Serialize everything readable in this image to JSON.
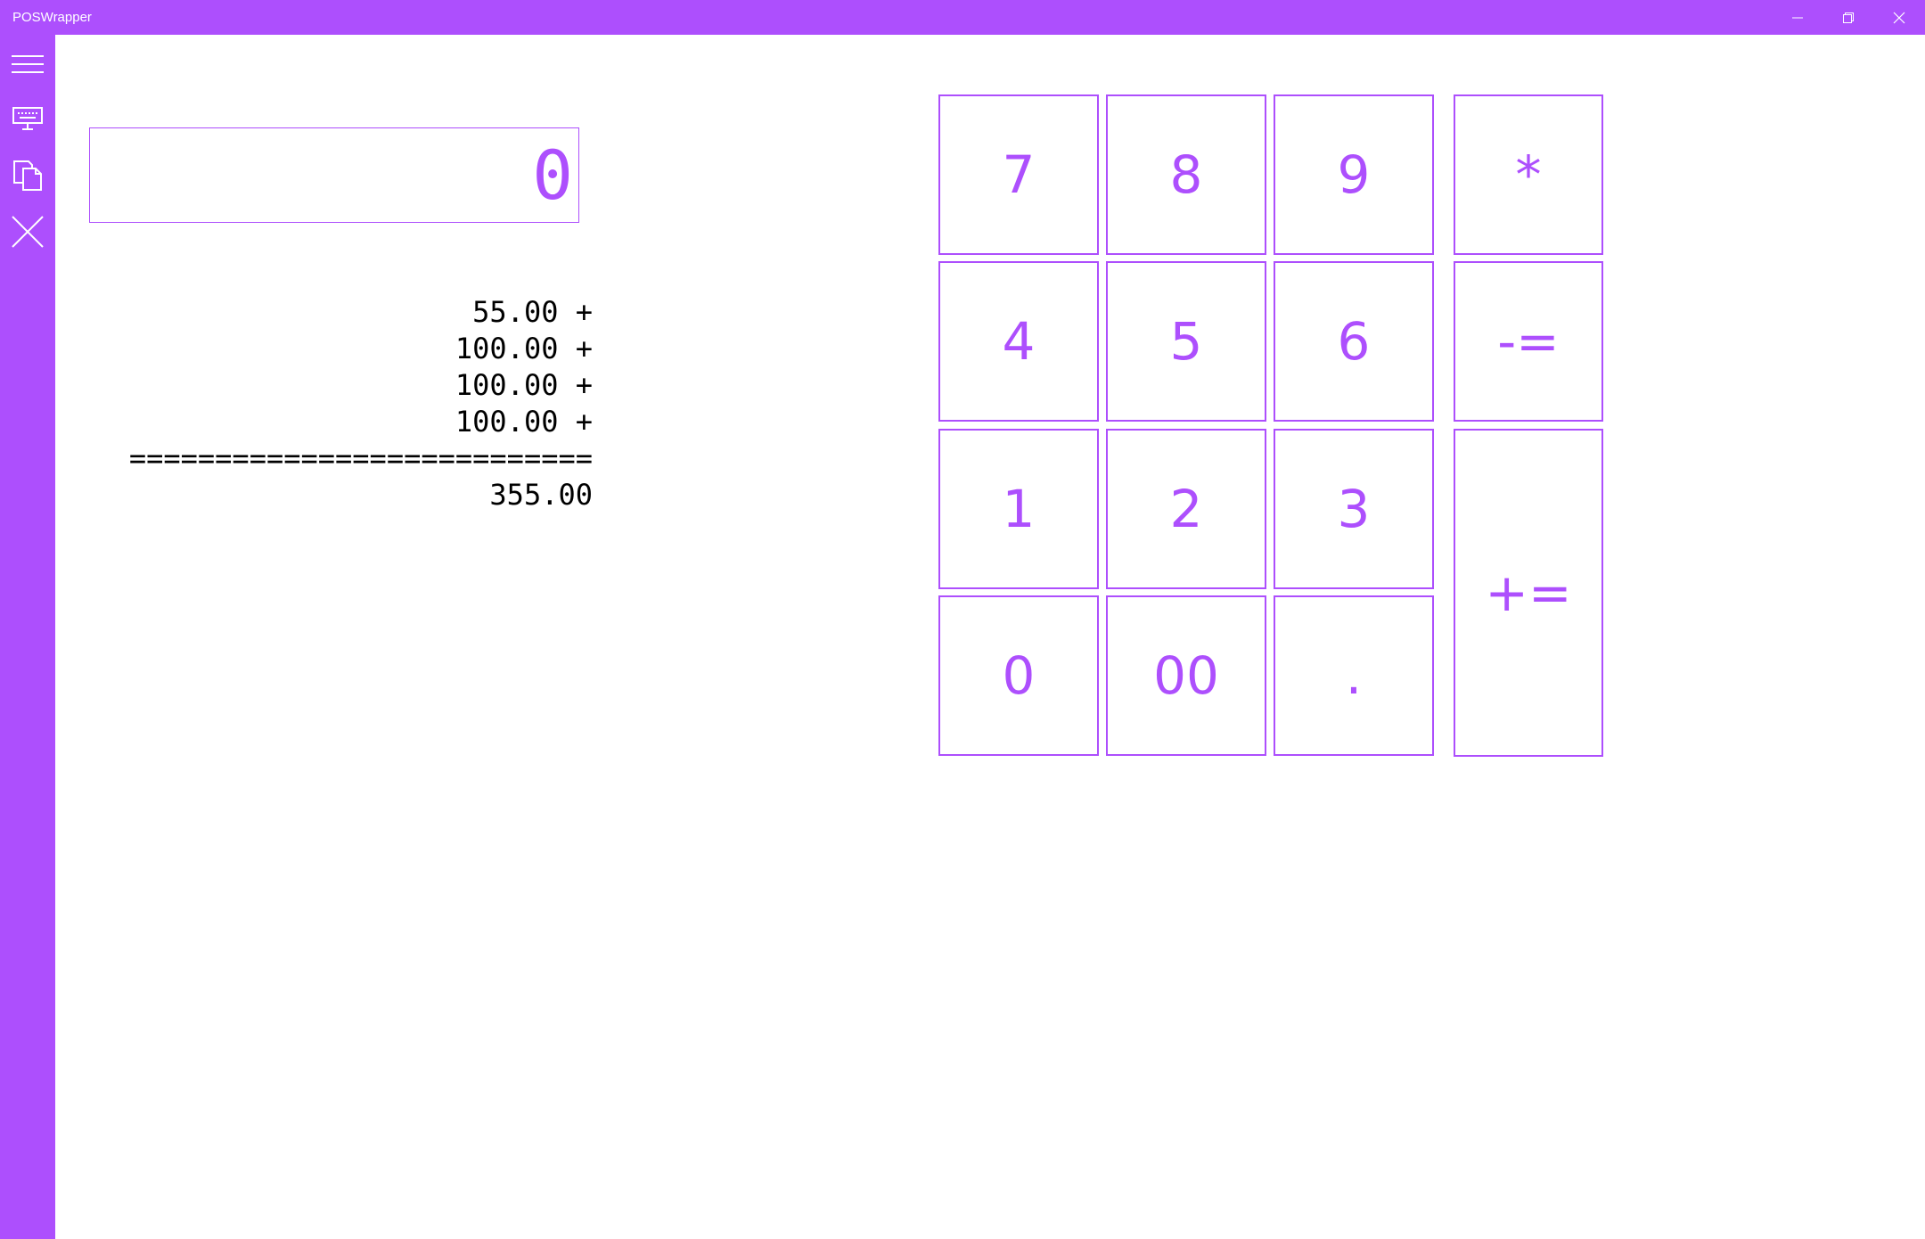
{
  "window": {
    "title": "POSWrapper",
    "controls": {
      "minimize_icon": "minimize-icon",
      "restore_icon": "restore-icon",
      "close_icon": "close-icon"
    }
  },
  "colors": {
    "accent": "#ad4ffd",
    "background": "#ffffff",
    "tape_text": "#000000"
  },
  "sidebar": {
    "items": [
      {
        "icon": "hamburger-menu-icon"
      },
      {
        "icon": "keyboard-icon"
      },
      {
        "icon": "copy-icon"
      },
      {
        "icon": "close-icon"
      }
    ]
  },
  "display": {
    "value": "0"
  },
  "tape": {
    "lines": [
      "55.00 +",
      "100.00 +",
      "100.00 +",
      "100.00 +",
      "===========================",
      "355.00"
    ]
  },
  "keypad": {
    "keys": [
      {
        "label": "7"
      },
      {
        "label": "8"
      },
      {
        "label": "9"
      },
      {
        "label": "*"
      },
      {
        "label": "4"
      },
      {
        "label": "5"
      },
      {
        "label": "6"
      },
      {
        "label": "-="
      },
      {
        "label": "1"
      },
      {
        "label": "2"
      },
      {
        "label": "3"
      },
      {
        "label": "+="
      },
      {
        "label": "0"
      },
      {
        "label": "00"
      },
      {
        "label": "."
      }
    ]
  }
}
